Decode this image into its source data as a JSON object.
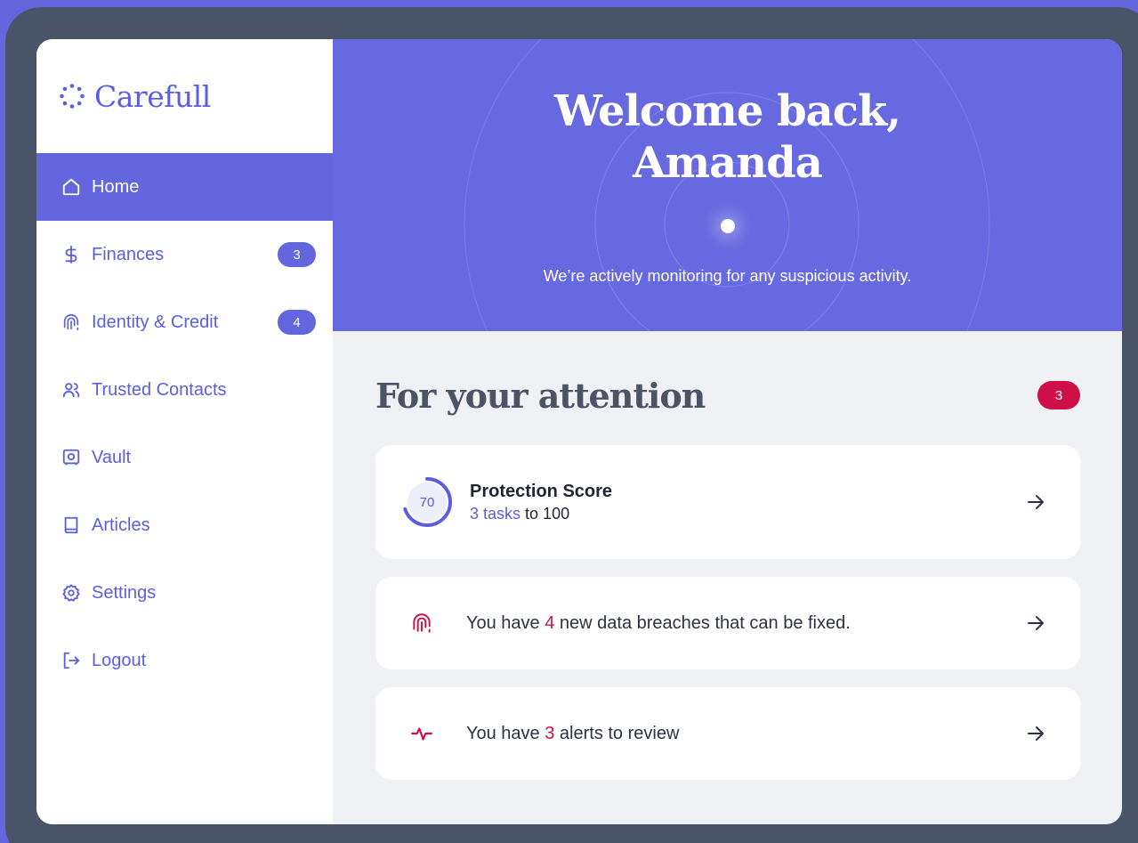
{
  "app": {
    "name": "Carefull"
  },
  "sidebar": {
    "items": [
      {
        "label": "Home",
        "icon": "home-icon",
        "active": true
      },
      {
        "label": "Finances",
        "icon": "dollar-icon",
        "badge": "3"
      },
      {
        "label": "Identity & Credit",
        "icon": "fingerprint-icon",
        "badge": "4"
      },
      {
        "label": "Trusted Contacts",
        "icon": "users-icon"
      },
      {
        "label": "Vault",
        "icon": "vault-icon"
      },
      {
        "label": "Articles",
        "icon": "book-icon"
      },
      {
        "label": "Settings",
        "icon": "gear-icon"
      },
      {
        "label": "Logout",
        "icon": "logout-icon"
      }
    ]
  },
  "hero": {
    "greeting_line1": "Welcome back,",
    "greeting_line2": "Amanda",
    "status": "We’re actively monitoring for any suspicious activity."
  },
  "attention": {
    "title": "For your attention",
    "count": "3",
    "score": {
      "title": "Protection Score",
      "value": "70",
      "progress": 0.7,
      "tasks": "3 tasks",
      "suffix": "to 100"
    },
    "breaches": {
      "prefix": "You have ",
      "count": "4",
      "suffix": " new data breaches that can be fixed."
    },
    "alerts": {
      "prefix": "You have ",
      "count": "3",
      "suffix": " alerts to review"
    }
  },
  "colors": {
    "brand": "#6366dd",
    "alert": "#cf1048",
    "frame": "#4a5468",
    "background": "#f0f1f5"
  }
}
